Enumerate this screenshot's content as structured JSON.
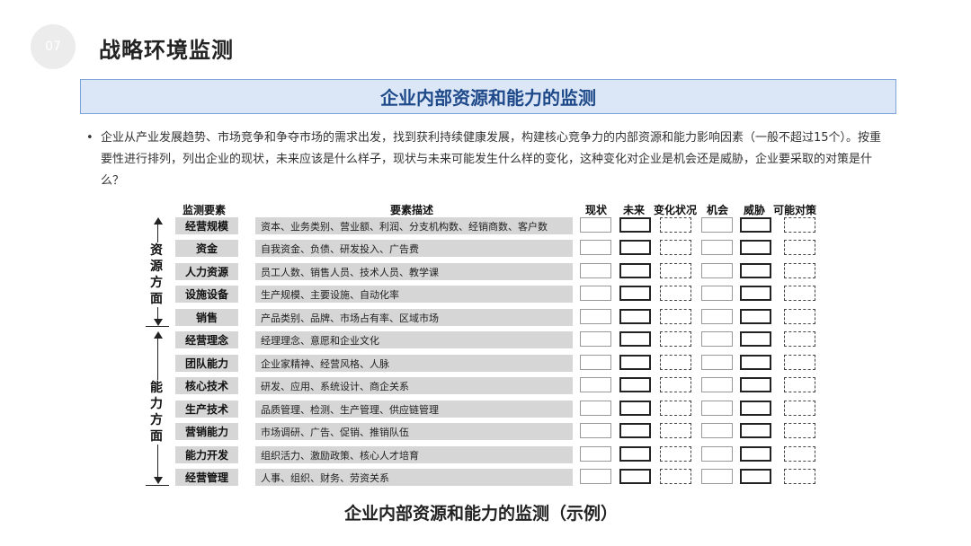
{
  "page": {
    "number": "07",
    "title": "战略环境监测"
  },
  "banner": {
    "title": "企业内部资源和能力的监测"
  },
  "intro": {
    "bullet": "•",
    "text": "企业从产业发展趋势、市场竞争和争夺市场的需求出发，找到获利持续健康发展，构建核心竞争力的内部资源和能力影响因素（一般不超过15个）。按重要性进行排列，列出企业的现状，未来应该是什么样子，现状与未来可能发生什么样的变化，这种变化对企业是机会还是威胁，企业要采取的对策是什么？"
  },
  "table": {
    "headers": {
      "factor": "监测要素",
      "description": "要素描述",
      "status": "现状",
      "future": "未来",
      "change": "变化状况",
      "opportunity": "机会",
      "threat": "威胁",
      "action": "可能对策"
    },
    "groups": [
      {
        "label": "资源方面"
      },
      {
        "label": "能力方面"
      }
    ],
    "rows": [
      {
        "factor": "经营规模",
        "description": "资本、业务类别、营业额、利润、分支机构数、经销商数、客户数"
      },
      {
        "factor": "资金",
        "description": "自我资金、负债、研发投入、广告费"
      },
      {
        "factor": "人力资源",
        "description": "员工人数、销售人员、技术人员、教学课"
      },
      {
        "factor": "设施设备",
        "description": "生产规模、主要设施、自动化率"
      },
      {
        "factor": "销售",
        "description": "产品类别、品牌、市场占有率、区域市场"
      },
      {
        "factor": "经营理念",
        "description": "经理理念、意愿和企业文化"
      },
      {
        "factor": "团队能力",
        "description": "企业家精神、经营风格、人脉"
      },
      {
        "factor": "核心技术",
        "description": "研发、应用、系统设计、商企关系"
      },
      {
        "factor": "生产技术",
        "description": "品质管理、检测、生产管理、供应链管理"
      },
      {
        "factor": "营销能力",
        "description": "市场调研、广告、促销、推销队伍"
      },
      {
        "factor": "能力开发",
        "description": "组织活力、激励政策、核心人才培育"
      },
      {
        "factor": "经营管理",
        "description": "人事、组织、财务、劳资关系"
      }
    ]
  },
  "caption": "企业内部资源和能力的监测（示例）"
}
